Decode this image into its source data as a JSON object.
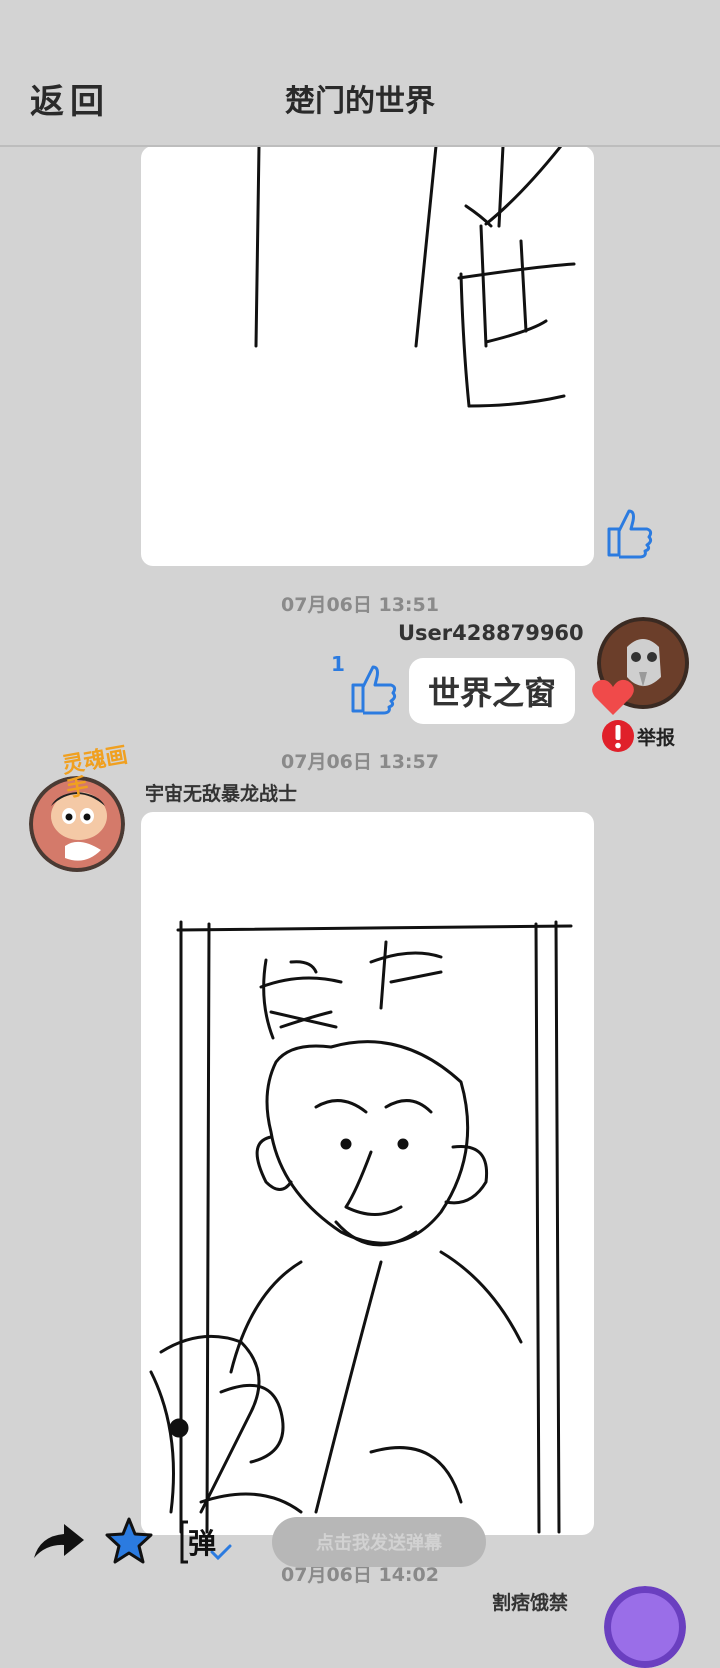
{
  "header": {
    "back_label": "返回",
    "title": "楚门的世界"
  },
  "messages": [
    {
      "time": "07月06日  13:51",
      "user": "User428879960",
      "text": "世界之窗",
      "likes": "1",
      "report_label": "举报"
    },
    {
      "time": "07月06日  13:57",
      "user": "宇宙无敌暴龙战士",
      "avatar_badge": "灵魂画手"
    },
    {
      "time": "07月06日  14:02",
      "user": "割痞饿禁"
    }
  ],
  "toolbar": {
    "danmu_placeholder": "点击我发送弹幕",
    "danmu_icon_label": "弹"
  },
  "colors": {
    "background": "#d3d3d3",
    "accent_blue": "#2b7be0",
    "report_red": "#e0202a",
    "heart_red": "#f04a4a"
  },
  "icons": [
    "thumbs-up-icon",
    "heart-icon",
    "report-icon",
    "share-icon",
    "star-icon",
    "danmu-icon"
  ]
}
